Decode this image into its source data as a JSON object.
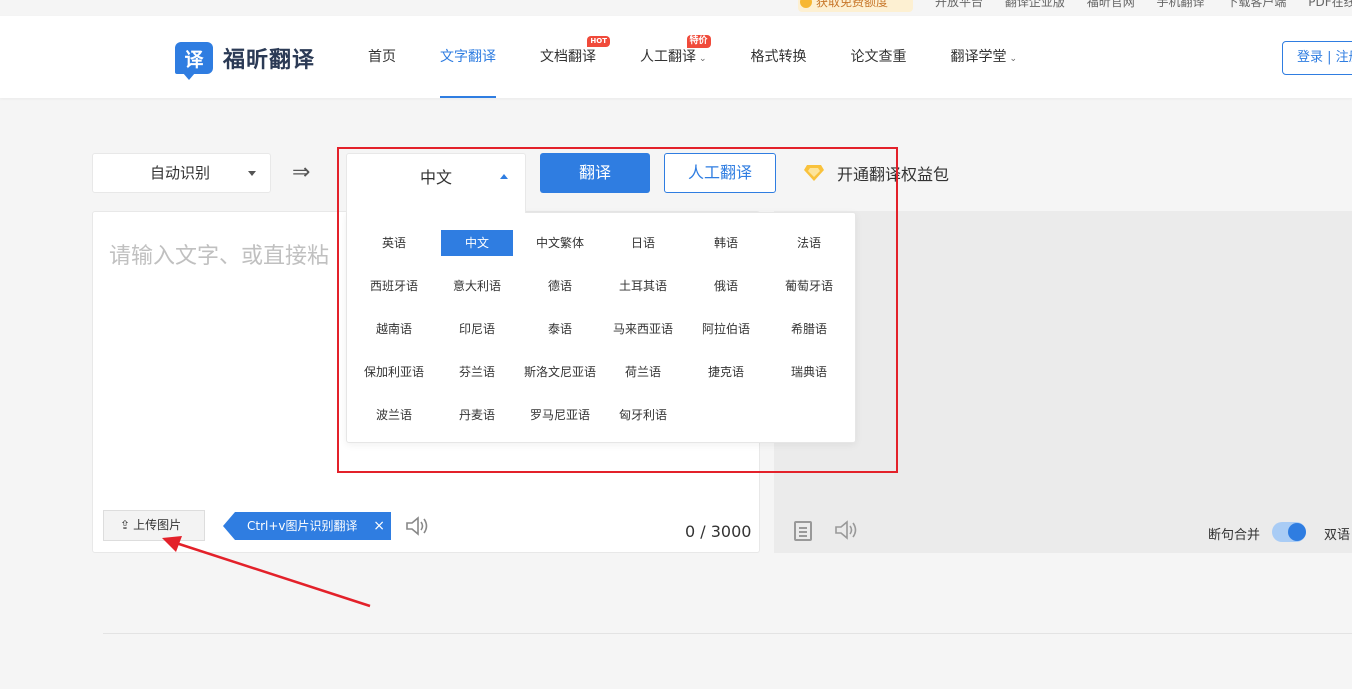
{
  "top_strip": {
    "promo": "获取免费额度",
    "links": [
      "开放平台",
      "翻译企业版",
      "福昕官网",
      "手机翻译",
      "下载客户端",
      "PDF在线"
    ]
  },
  "header": {
    "logo_mark": "译",
    "logo_text": "福昕翻译",
    "nav": [
      {
        "label": "首页"
      },
      {
        "label": "文字翻译",
        "active": true
      },
      {
        "label": "文档翻译",
        "badge": "HOT"
      },
      {
        "label": "人工翻译",
        "badge": "特价",
        "caret": true
      },
      {
        "label": "格式转换"
      },
      {
        "label": "论文查重"
      },
      {
        "label": "翻译学堂",
        "caret": true
      }
    ],
    "login_label": "登录 | 注册"
  },
  "controls": {
    "source_lang": "自动识别",
    "swap_icon": "⇒",
    "target_lang": "中文",
    "translate_label": "翻译",
    "human_label": "人工翻译",
    "vip_label": "开通翻译权益包"
  },
  "input_panel": {
    "placeholder": "请输入文字、或直接粘",
    "upload_label": "上传图片",
    "tip_label": "Ctrl+v图片识别翻译",
    "tip_close": "×",
    "count": "0",
    "separator": " / ",
    "max": "3000"
  },
  "output_panel": {
    "merge_label": "断句合并",
    "bilingual_label": "双语"
  },
  "dropdown": {
    "selected": "中文",
    "languages": [
      "英语",
      "中文",
      "中文繁体",
      "日语",
      "韩语",
      "法语",
      "西班牙语",
      "意大利语",
      "德语",
      "土耳其语",
      "俄语",
      "葡萄牙语",
      "越南语",
      "印尼语",
      "泰语",
      "马来西亚语",
      "阿拉伯语",
      "希腊语",
      "保加利亚语",
      "芬兰语",
      "斯洛文尼亚语",
      "荷兰语",
      "捷克语",
      "瑞典语",
      "波兰语",
      "丹麦语",
      "罗马尼亚语",
      "匈牙利语"
    ]
  },
  "colors": {
    "accent": "#2f7de1",
    "annotation": "#e3212a",
    "badge": "#f04a3a"
  }
}
